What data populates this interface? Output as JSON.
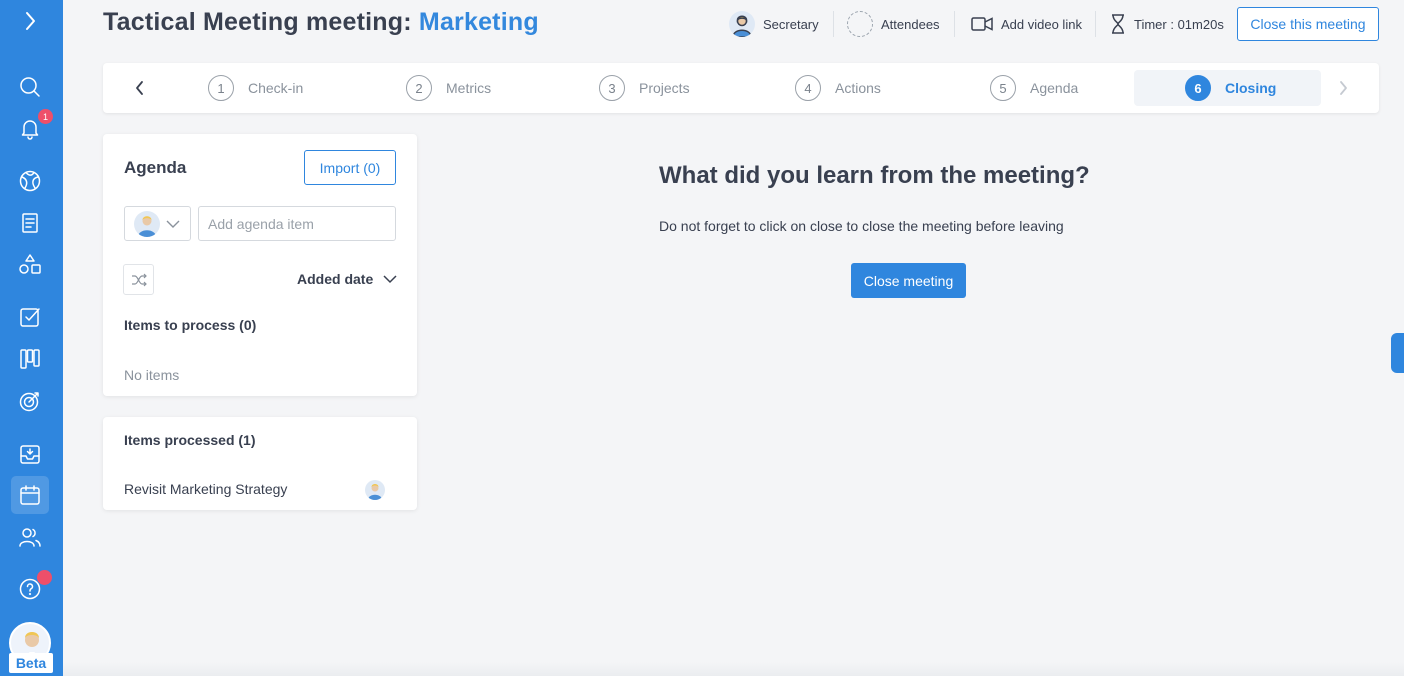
{
  "header": {
    "title_prefix": "Tactical Meeting meeting:",
    "title_accent": "Marketing",
    "secretary_label": "Secretary",
    "attendees_label": "Attendees",
    "video_label": "Add video link",
    "timer_label": "Timer : 01m20s",
    "close_button": "Close this meeting"
  },
  "nav": {
    "notification_count": "1",
    "beta_label": "Beta",
    "icons": [
      "search-icon",
      "bell-icon",
      "globe-icon",
      "document-icon",
      "shapes-icon",
      "checkbox-icon",
      "board-icon",
      "target-icon",
      "inbox-icon",
      "calendar-icon",
      "users-icon",
      "help-icon"
    ]
  },
  "steps": [
    {
      "number": "1",
      "label": "Check-in"
    },
    {
      "number": "2",
      "label": "Metrics"
    },
    {
      "number": "3",
      "label": "Projects"
    },
    {
      "number": "4",
      "label": "Actions"
    },
    {
      "number": "5",
      "label": "Agenda"
    },
    {
      "number": "6",
      "label": "Closing"
    }
  ],
  "active_step": "Closing",
  "agenda": {
    "title": "Agenda",
    "import_button": "Import (0)",
    "input_placeholder": "Add agenda item",
    "sort_label": "Added date",
    "to_process_label": "Items to process (0)",
    "empty_label": "No items"
  },
  "processed": {
    "label": "Items processed (1)",
    "items": [
      "Revisit Marketing Strategy"
    ]
  },
  "main": {
    "question": "What did you learn from the meeting?",
    "hint": "Do not forget to click on close to close the meeting before leaving",
    "close_button": "Close meeting"
  },
  "colors": {
    "primary": "#2f86de",
    "text": "#394050",
    "muted": "#8a929c",
    "badge": "#ee4f6a"
  }
}
